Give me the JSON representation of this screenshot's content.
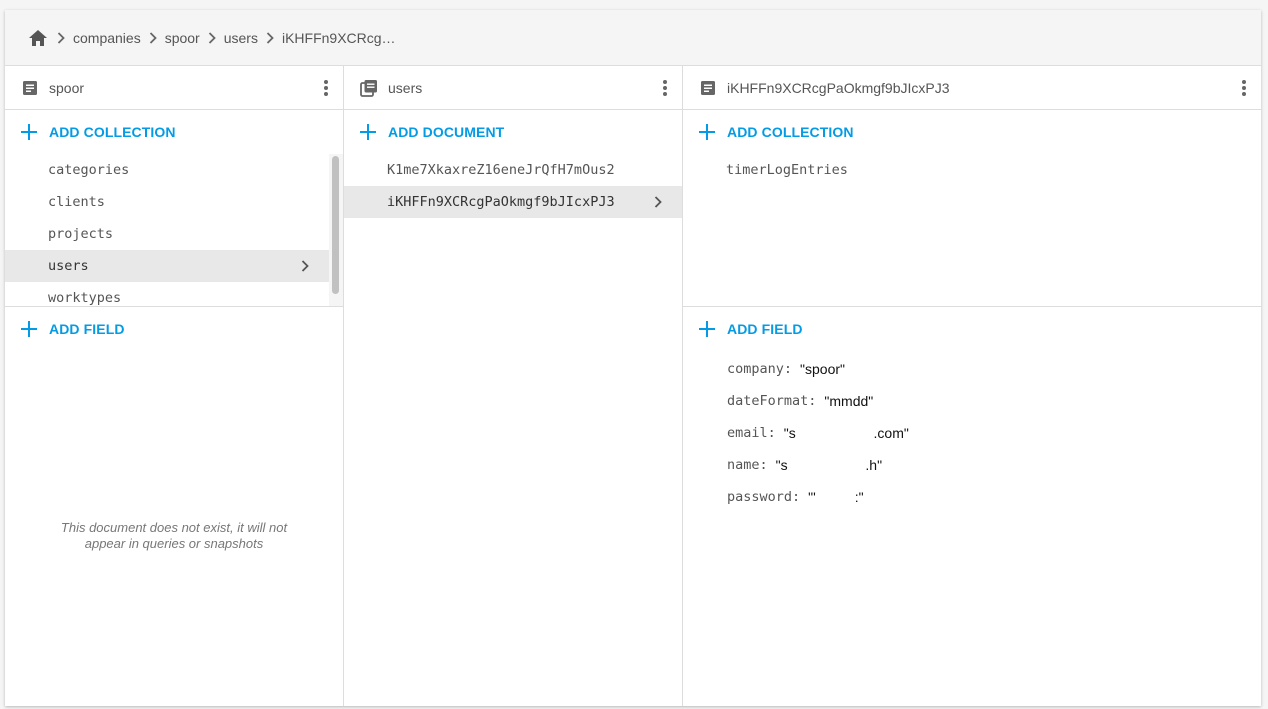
{
  "breadcrumb": {
    "items": [
      "companies",
      "spoor",
      "users",
      "iKHFFn9XCRcg…"
    ]
  },
  "panes": [
    {
      "title": "spoor",
      "add_label": "ADD COLLECTION",
      "items": [
        "categories",
        "clients",
        "projects",
        "users",
        "worktypes"
      ],
      "selected_index": 3,
      "add_field_label": "ADD FIELD",
      "empty_message": "This document does not exist, it will not appear in queries or snapshots"
    },
    {
      "title": "users",
      "add_label": "ADD DOCUMENT",
      "items": [
        "K1me7XkaxreZ16eneJrQfH7mOus2",
        "iKHFFn9XCRcgPaOkmgf9bJIcxPJ3"
      ],
      "selected_index": 1
    },
    {
      "title": "iKHFFn9XCRcgPaOkmgf9bJIcxPJ3",
      "add_label": "ADD COLLECTION",
      "items": [
        "timerLogEntries"
      ],
      "add_field_label": "ADD FIELD",
      "fields": [
        {
          "key": "company:",
          "value": "\"spoor\""
        },
        {
          "key": "dateFormat:",
          "value": "\"mmdd\""
        },
        {
          "key": "email:",
          "value": "\"s                    .com\""
        },
        {
          "key": "name:",
          "value": "\"s                    .h\""
        },
        {
          "key": "password:",
          "value": "\"'          :\""
        }
      ]
    }
  ],
  "colors": {
    "accent": "#039be5",
    "selected_row": "#e8e8e8"
  }
}
